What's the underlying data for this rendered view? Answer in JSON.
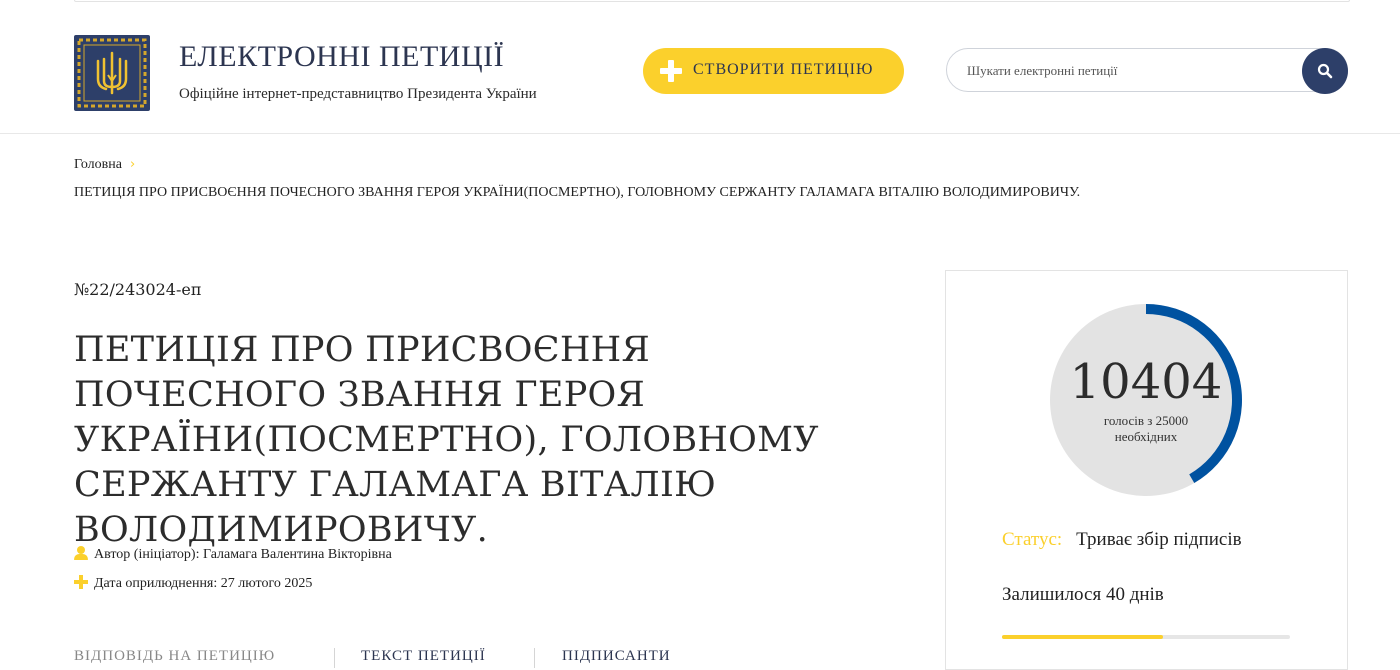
{
  "header": {
    "title": "ЕЛЕКТРОННІ ПЕТИЦІЇ",
    "subtitle": "Офіційне інтернет-представництво Президента України",
    "create_button": "СТВОРИТИ ПЕТИЦІЮ",
    "search_placeholder": "Шукати електронні петиції"
  },
  "breadcrumb": {
    "home": "Головна",
    "separator": "›",
    "current": "ПЕТИЦІЯ ПРО ПРИСВОЄННЯ ПОЧЕСНОГО ЗВАННЯ ГЕРОЯ УКРАЇНИ(ПОСМЕРТНО), ГОЛОВНОМУ СЕРЖАНТУ ГАЛАМАГА ВІТАЛІЮ ВОЛОДИМИРОВИЧУ."
  },
  "petition": {
    "number": "№22/243024-еп",
    "title": "ПЕТИЦІЯ ПРО ПРИСВОЄННЯ ПОЧЕСНОГО ЗВАННЯ ГЕРОЯ УКРАЇНИ(ПОСМЕРТНО), ГОЛОВНОМУ СЕРЖАНТУ ГАЛАМАГА ВІТАЛІЮ ВОЛОДИМИРОВИЧУ.",
    "author": "Автор (ініціатор): Галамага Валентина Вікторівна",
    "date": "Дата оприлюднення: 27 лютого 2025"
  },
  "tabs": [
    {
      "label": "ВІДПОВІДЬ НА ПЕТИЦІЮ"
    },
    {
      "label": "ТЕКСТ ПЕТИЦІЇ"
    },
    {
      "label": "ПІДПИСАНТИ"
    }
  ],
  "votes": {
    "count": "10404",
    "count_value": 10404,
    "needed_value": 25000,
    "subtitle_line1": "голосів з 25000",
    "subtitle_line2": "необхідних",
    "status_label": "Статус:",
    "status_value": "Триває збір підписів",
    "remaining": "Залишилося 40 днів",
    "remaining_fraction": 0.56
  },
  "colors": {
    "accent": "#fbd02c",
    "navy": "#2d3f69",
    "gauge_arc": "#0052a0",
    "gauge_bg": "#e3e3e3"
  },
  "icons": {
    "logo": "trident-emblem",
    "search": "search-icon",
    "create": "plus-icon",
    "author": "user-icon",
    "date": "plus-icon"
  }
}
